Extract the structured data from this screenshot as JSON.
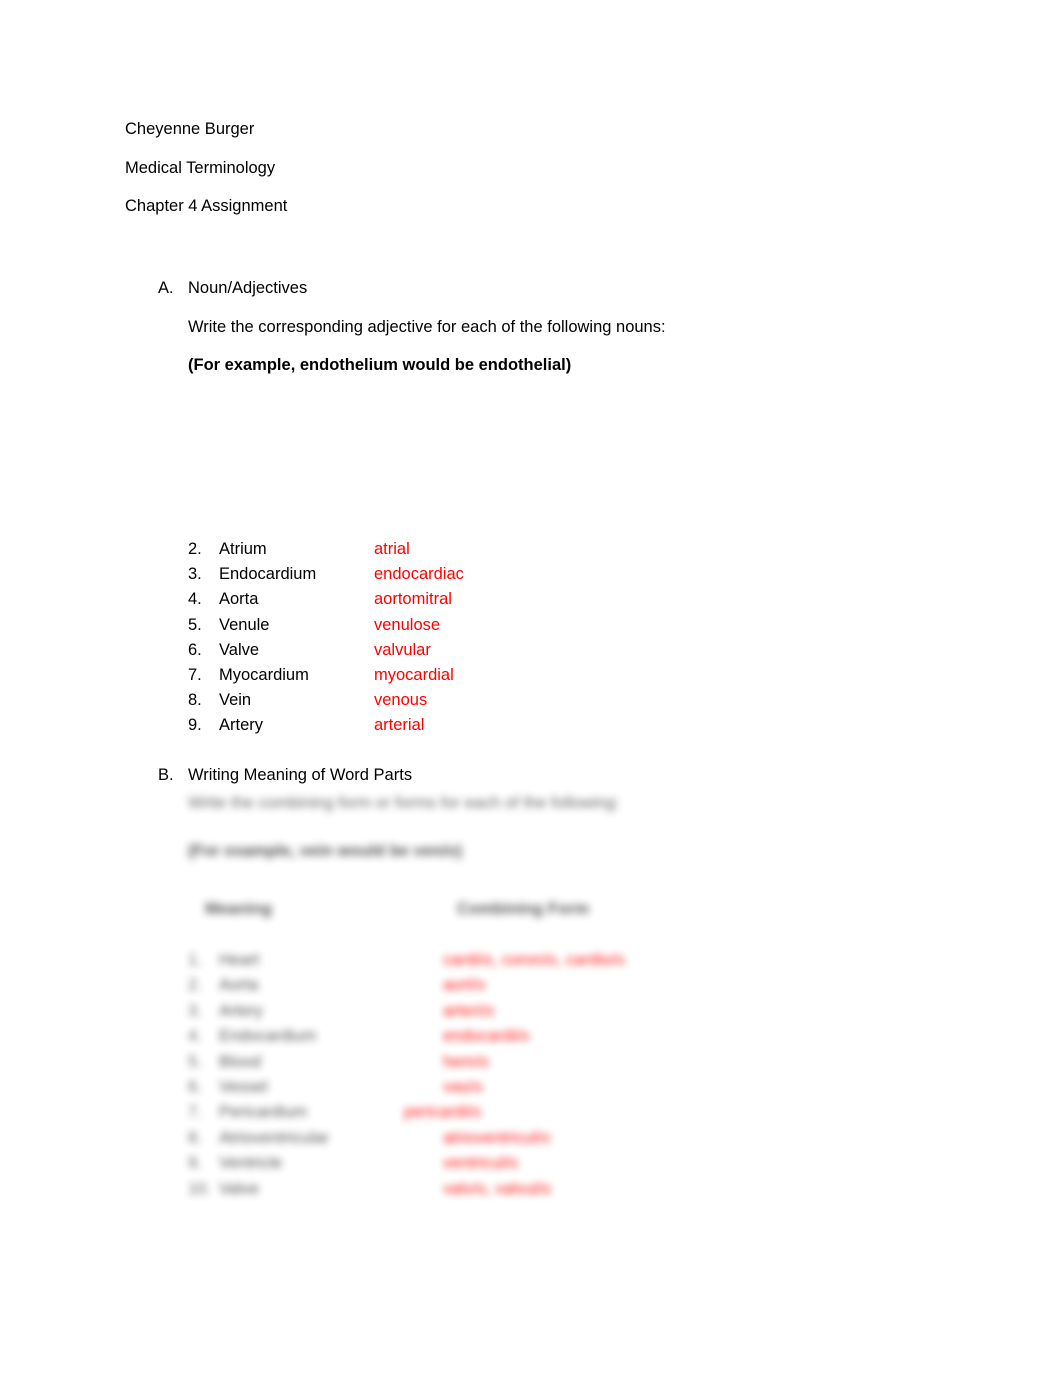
{
  "document": {
    "header_lines": [
      "Cheyenne Burger",
      "Medical Terminology",
      "Chapter 4 Assignment"
    ]
  },
  "section_a": {
    "letter": "A.",
    "title": "Noun/Adjectives",
    "instruction": "Write the corresponding adjective for each of the following nouns:",
    "example": "(For example, endothelium would be endothelial)",
    "items": [
      {
        "num": "2.",
        "term": "Atrium",
        "answer": "atrial"
      },
      {
        "num": "3.",
        "term": "Endocardium",
        "answer": "endocardiac"
      },
      {
        "num": "4.",
        "term": "Aorta",
        "answer": "aortomitral"
      },
      {
        "num": "5.",
        "term": "Venule",
        "answer": "venulose"
      },
      {
        "num": "6.",
        "term": "Valve",
        "answer": "valvular"
      },
      {
        "num": "7.",
        "term": "Myocardium",
        "answer": "myocardial"
      },
      {
        "num": "8.",
        "term": "Vein",
        "answer": "venous"
      },
      {
        "num": "9.",
        "term": "Artery",
        "answer": "arterial"
      }
    ]
  },
  "section_b": {
    "letter": "B.",
    "title": "Writing Meaning of Word Parts",
    "instruction_blurred": "Write the combining form or forms for each of the following:",
    "example_blurred": "(For example, vein would be ven/o)",
    "table": {
      "headers": {
        "meaning": "Meaning",
        "combining_form": "Combining Form"
      },
      "rows": [
        {
          "num": "1.",
          "term": "Heart",
          "answer": "cardi/o, coron/o, cardio/o"
        },
        {
          "num": "2.",
          "term": "Aorta",
          "answer": "aort/o"
        },
        {
          "num": "3.",
          "term": "Artery",
          "answer": "arteri/o"
        },
        {
          "num": "4.",
          "term": "Endocardium",
          "answer": "endocardi/o"
        },
        {
          "num": "5.",
          "term": "Blood",
          "answer": "hem/o"
        },
        {
          "num": "6.",
          "term": "Vessel",
          "answer": "vas/o"
        },
        {
          "num": "7.",
          "term": "Pericardium",
          "answer": "pericardi/o"
        },
        {
          "num": "8.",
          "term": "Atrioventricular",
          "answer": "atrioventricul/o"
        },
        {
          "num": "9.",
          "term": "Ventricle",
          "answer": "ventricul/o"
        },
        {
          "num": "10.",
          "term": "Valve",
          "answer": "valv/o, valvul/o"
        }
      ]
    }
  },
  "colors": {
    "answer_red": "#FF0000",
    "text_black": "#000000",
    "page_background": "#FFFFFF"
  }
}
